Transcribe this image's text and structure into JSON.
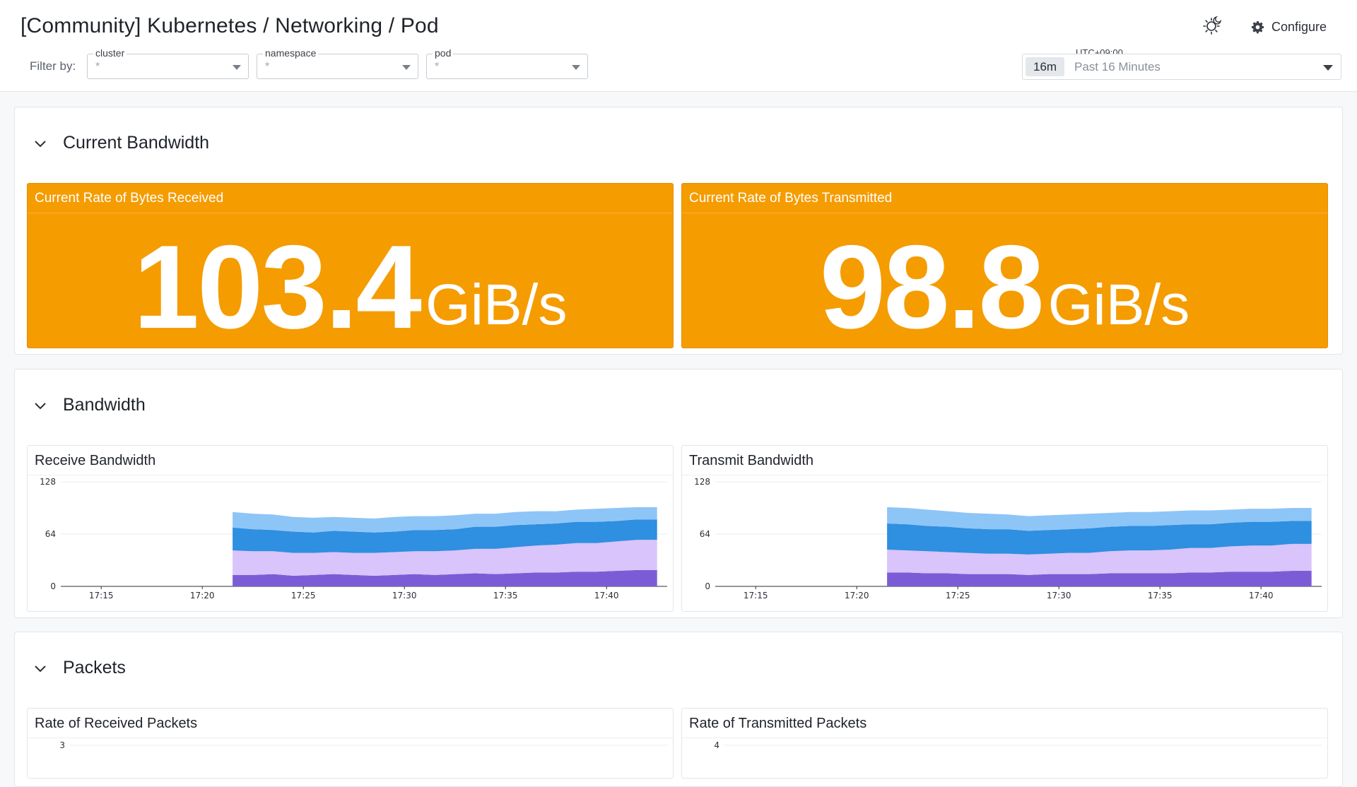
{
  "header": {
    "title": "[Community] Kubernetes / Networking / Pod",
    "configure_label": "Configure",
    "filter_by_label": "Filter by:",
    "filters": [
      {
        "label": "cluster",
        "value": "*"
      },
      {
        "label": "namespace",
        "value": "*"
      },
      {
        "label": "pod",
        "value": "*"
      }
    ],
    "timezone": "UTC+09:00",
    "time_range_short": "16m",
    "time_range_label": "Past 16 Minutes"
  },
  "sections": {
    "current_bandwidth": {
      "title": "Current Bandwidth",
      "received": {
        "title": "Current Rate of Bytes Received",
        "value": "103.4",
        "unit": "GiB/s"
      },
      "transmitted": {
        "title": "Current Rate of Bytes Transmitted",
        "value": "98.8",
        "unit": "GiB/s"
      }
    },
    "bandwidth": {
      "title": "Bandwidth",
      "receive_title": "Receive Bandwidth",
      "transmit_title": "Transmit Bandwidth"
    },
    "packets": {
      "title": "Packets",
      "received_title": "Rate of Received Packets",
      "transmitted_title": "Rate of Transmitted Packets",
      "received_top_tick": "3",
      "transmitted_top_tick": "4"
    }
  },
  "colors": {
    "stat_orange": "#f59c01",
    "series": [
      "#7c5cd6",
      "#d9c4fb",
      "#2f8fe0",
      "#8ec5f7"
    ]
  },
  "chart_data": [
    {
      "type": "area",
      "title": "Receive Bandwidth",
      "stacked": true,
      "ylim": [
        0,
        128
      ],
      "yticks": [
        0,
        64,
        128
      ],
      "xlim": [
        "17:13",
        "17:43"
      ],
      "xticks": [
        "17:15",
        "17:20",
        "17:25",
        "17:30",
        "17:35",
        "17:40"
      ],
      "data_start": "17:21:30",
      "data_end": "17:42:30",
      "series": [
        {
          "color": "#7c5cd6",
          "values": [
            14,
            14,
            15,
            13,
            14,
            15,
            14,
            13,
            14,
            15,
            14,
            15,
            16,
            15,
            16,
            17,
            17,
            18,
            18,
            19,
            20,
            20
          ]
        },
        {
          "color": "#d9c4fb",
          "values": [
            30,
            29,
            28,
            28,
            27,
            27,
            27,
            28,
            28,
            28,
            29,
            29,
            30,
            31,
            32,
            33,
            34,
            35,
            35,
            36,
            37,
            37
          ]
        },
        {
          "color": "#2f8fe0",
          "values": [
            28,
            27,
            26,
            26,
            25,
            26,
            26,
            25,
            25,
            26,
            26,
            26,
            27,
            27,
            27,
            26,
            26,
            26,
            26,
            25,
            25,
            25
          ]
        },
        {
          "color": "#8ec5f7",
          "values": [
            19,
            19,
            19,
            18,
            18,
            17,
            17,
            17,
            18,
            17,
            17,
            17,
            16,
            16,
            16,
            16,
            15,
            15,
            16,
            16,
            15,
            15
          ]
        }
      ]
    },
    {
      "type": "area",
      "title": "Transmit Bandwidth",
      "stacked": true,
      "ylim": [
        0,
        128
      ],
      "yticks": [
        0,
        64,
        128
      ],
      "xlim": [
        "17:13",
        "17:43"
      ],
      "xticks": [
        "17:15",
        "17:20",
        "17:25",
        "17:30",
        "17:35",
        "17:40"
      ],
      "data_start": "17:21:30",
      "data_end": "17:42:30",
      "series": [
        {
          "color": "#7c5cd6",
          "values": [
            17,
            17,
            16,
            16,
            15,
            15,
            15,
            14,
            15,
            15,
            15,
            16,
            16,
            16,
            16,
            17,
            17,
            18,
            18,
            18,
            19,
            19
          ]
        },
        {
          "color": "#d9c4fb",
          "values": [
            28,
            27,
            27,
            26,
            26,
            25,
            25,
            25,
            25,
            26,
            26,
            27,
            28,
            28,
            29,
            30,
            30,
            31,
            32,
            32,
            33,
            33
          ]
        },
        {
          "color": "#2f8fe0",
          "values": [
            32,
            32,
            31,
            31,
            30,
            30,
            30,
            29,
            29,
            29,
            30,
            30,
            30,
            30,
            30,
            29,
            29,
            29,
            29,
            29,
            28,
            28
          ]
        },
        {
          "color": "#8ec5f7",
          "values": [
            20,
            20,
            20,
            19,
            19,
            19,
            18,
            18,
            18,
            18,
            18,
            17,
            17,
            17,
            17,
            17,
            17,
            16,
            16,
            16,
            16,
            16
          ]
        }
      ]
    }
  ]
}
